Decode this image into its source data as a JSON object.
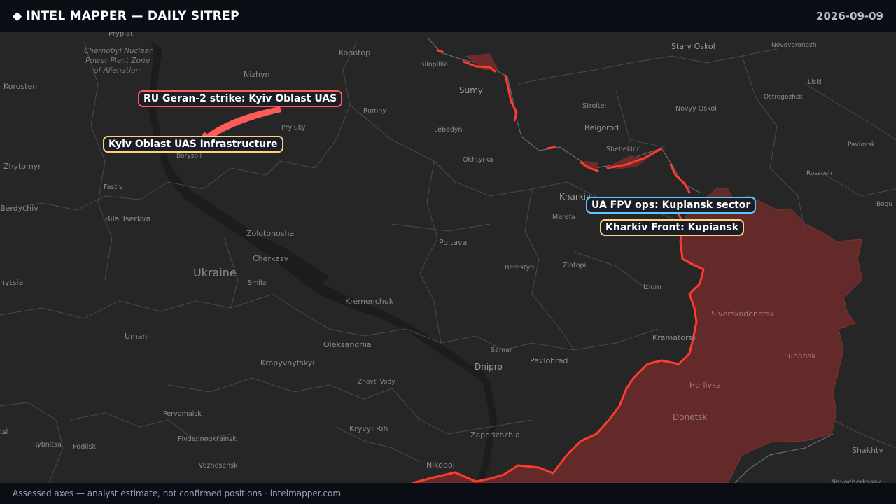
{
  "header": {
    "diamond": "◆",
    "title": "INTEL MAPPER — DAILY SITREP",
    "date": "2026-09-09"
  },
  "footer": {
    "text": "Assessed axes — analyst estimate, not confirmed positions · intelmapper.com"
  },
  "colors": {
    "occupied_fill": "#6b2b2b",
    "front_line": "#ff3b30",
    "strike_arrow": "#ff5a5a",
    "callout_red": "#ff5a5a",
    "callout_yellow": "#ffd27a",
    "callout_blue": "#5ac8ff"
  },
  "callouts": {
    "ru_strike": "RU Geran-2 strike: Kyiv Oblast UAS",
    "kyiv_uas": "Kyiv Oblast UAS Infrastructure",
    "ua_fpv": "UA FPV ops: Kupiansk sector",
    "kharkiv_front": "Kharkiv Front: Kupiansk"
  },
  "map_labels": {
    "chernobyl_1": "Chernobyl Nuclear",
    "chernobyl_2": "Power Plant Zone",
    "chernobyl_3": "of Alienation",
    "pryp": "Prypiat",
    "korosten": "Korosten",
    "nizhyn": "Nizhyn",
    "konotop": "Konotop",
    "bilopillia": "Bilopillia",
    "sumy": "Sumy",
    "romny": "Romny",
    "pryluky": "Pryluky",
    "lebedyn": "Lebedyn",
    "okhtyrka": "Okhtyrka",
    "stary_oskol": "Stary Oskol",
    "novovoronezh": "Novovoronezh",
    "stroitel": "Stroitel",
    "novyy_oskol": "Novyy Oskol",
    "ostrogozhsk": "Ostrogozhsk",
    "liski": "Liski",
    "belgorod": "Belgorod",
    "shebekino": "Shebekino",
    "pavlovsk": "Pavlovsk",
    "rossosh": "Rossosh",
    "bogu": "Bogu",
    "zhytomyr": "Zhytomyr",
    "fastiv": "Fastiv",
    "boryspil": "Boryspil",
    "berdychiv": "Berdychiv",
    "bila_tserkva": "Bila Tserkva",
    "zolotonosha": "Zolotonosha",
    "cherkasy": "Cherkasy",
    "ukraine": "Ukraine",
    "smila": "Smila",
    "poltava": "Poltava",
    "kharkiv": "Kharkiv",
    "merefa": "Merefa",
    "berestyn": "Berestyn",
    "zlatopil": "Zlatopil",
    "izium": "Izium",
    "siverskodonetsk": "Siverskodonetsk",
    "kramatorsk": "Kramatorsk",
    "luhansk": "Luhansk",
    "horlivka": "Horlivka",
    "donetsk": "Donetsk",
    "shakhty": "Shakhty",
    "novocherkassk": "Novocherkassk",
    "nytsia": "nytsia",
    "kremenchuk": "Kremenchuk",
    "uman": "Uman",
    "oleksandriia": "Oleksandriia",
    "kropyvnytskyi": "Kropyvnytskyi",
    "zhovti_vody": "Zhovti Vody",
    "samar": "Samar",
    "dnipro": "Dnipro",
    "pavlohrad": "Pavlohrad",
    "pervomaisk": "Pervomaisk",
    "pivdennoukrainsk": "Pivdennoukrainsk",
    "kryvyi_rih": "Kryvyi Rih",
    "zaporizhzhia": "Zaporizhzhia",
    "rybnitsa": "Rybnitsa",
    "podilsk": "Podilsk",
    "voznesensk": "Voznesensk",
    "nikopol": "Nikopol",
    "tsi": "tsi"
  }
}
